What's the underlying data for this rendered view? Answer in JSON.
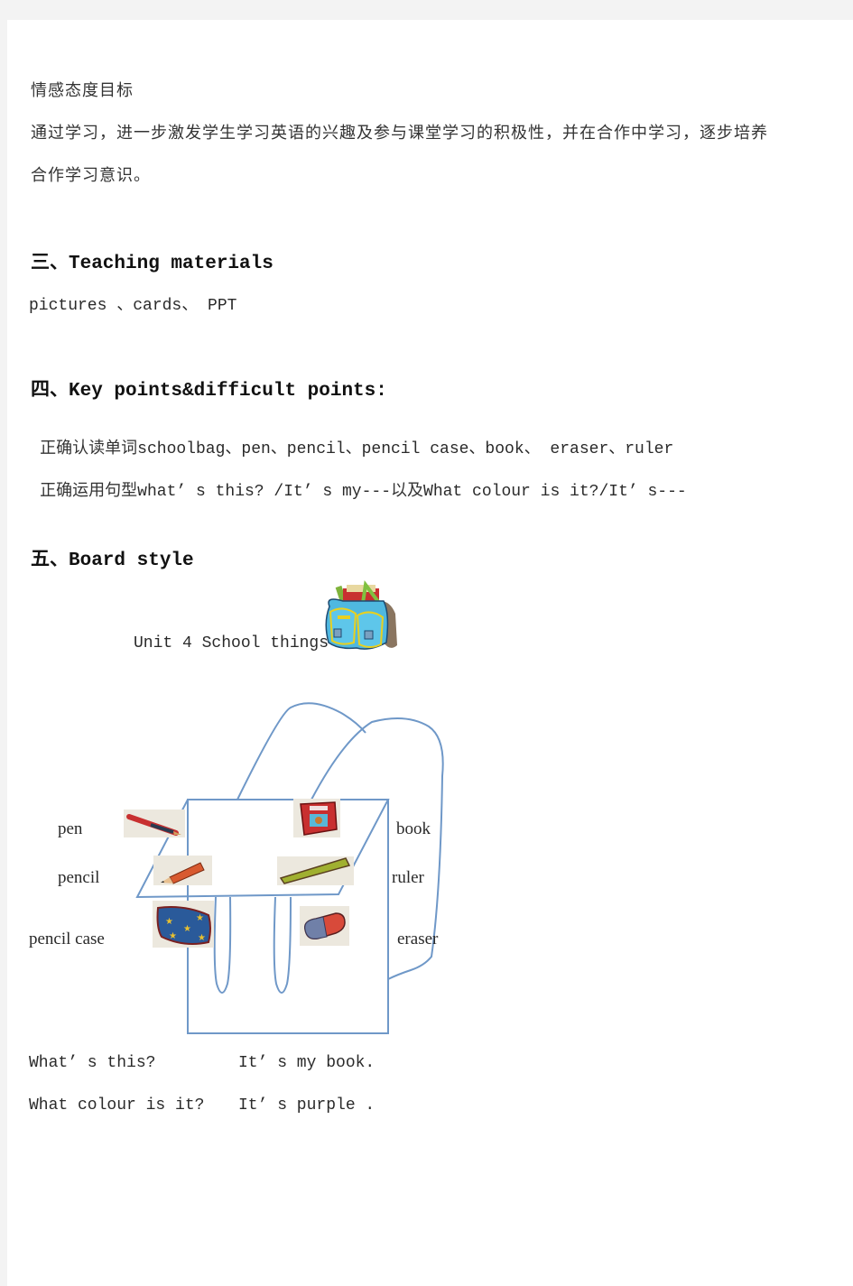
{
  "affective_goals": {
    "title": "情感态度目标",
    "body_line1": "通过学习，进一步激发学生学习英语的兴趣及参与课堂学习的积极性，并在合作中学习，逐步培养",
    "body_line2": "合作学习意识。"
  },
  "section3": {
    "heading": "三、Teaching materials",
    "content": "pictures 、cards、 PPT"
  },
  "section4": {
    "heading": "四、Key points&difficult points:",
    "line1_cn": "正确认读单词",
    "line1_en": "schoolbag、pen、pencil、pencil case、book、 eraser、ruler",
    "line2_cn": "正确运用句型",
    "line2_en1": "what’ s this? /It’ s my---",
    "line2_cn2": "以及",
    "line2_en2": "What colour is it?/It’ s---"
  },
  "section5": {
    "heading": "五、Board style",
    "unit_title": "Unit 4 School things",
    "schoolbag_icon": "schoolbag-icon",
    "labels": {
      "pen": "pen",
      "pencil": "pencil",
      "pencil_case": "pencil case",
      "book": "book",
      "ruler": "ruler",
      "eraser": "eraser"
    },
    "dialogue": [
      {
        "q": "What’ s this?",
        "a": "It’ s my book."
      },
      {
        "q": "What colour is it?",
        "a": "It’ s purple ."
      }
    ]
  },
  "colors": {
    "diagram_line": "#6f98c8"
  }
}
